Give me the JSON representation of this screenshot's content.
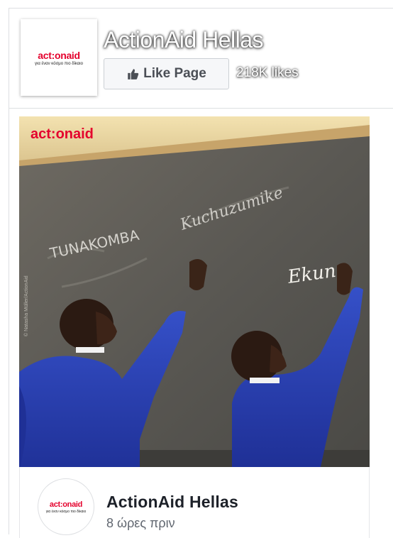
{
  "page": {
    "name": "ActionAid Hellas",
    "likes": "218K likes",
    "like_button": "Like Page",
    "logo_word_left": "act",
    "logo_word_colon": ":",
    "logo_word_right": "onaid",
    "logo_tagline": "για έναν κόσμο πιο δίκαιο"
  },
  "post": {
    "image_logo": "act:onaid",
    "photo_credit": "© Natasha Müller/ActionAid",
    "chalk_text_1": "TUNAKOMBA",
    "chalk_text_2": "Kuchuzumike",
    "chalk_text_3": "Ekun",
    "author": "ActionAid Hellas",
    "timestamp": "8 ώρες πριν"
  },
  "colors": {
    "brand_red": "#e4022d",
    "shirt_blue": "#2a3fb0",
    "board": "#5c5a55"
  },
  "icons": {
    "like": "thumbs-up-icon"
  }
}
